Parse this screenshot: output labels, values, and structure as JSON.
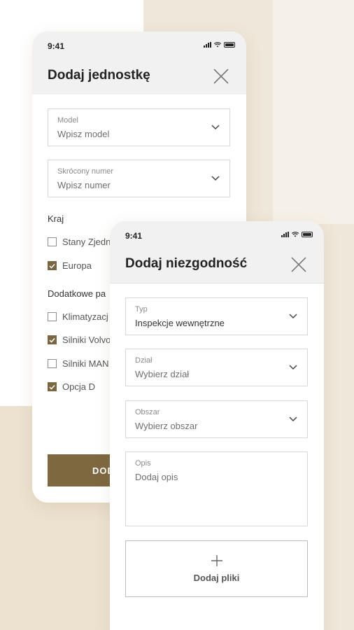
{
  "colors": {
    "accent": "#7d6840",
    "background": "#f3ede2",
    "header": "#f1f1f1"
  },
  "screen1": {
    "status_time": "9:41",
    "title": "Dodaj jednostkę",
    "fields": [
      {
        "label": "Model",
        "placeholder": "Wpisz model"
      },
      {
        "label": "Skrócony numer",
        "placeholder": "Wpisz numer"
      }
    ],
    "country_label": "Kraj",
    "countries": [
      {
        "label": "Stany Zjedn",
        "checked": false
      },
      {
        "label": "Europa",
        "checked": true
      }
    ],
    "params_label": "Dodatkowe pa",
    "params": [
      {
        "label": "Klimatyzacj",
        "checked": false
      },
      {
        "label": "Silniki Volvo",
        "checked": true
      },
      {
        "label": "Silniki MAN",
        "checked": false
      },
      {
        "label": "Opcja D",
        "checked": true
      }
    ],
    "submit_label": "DOD"
  },
  "screen2": {
    "status_time": "9:41",
    "title": "Dodaj niezgodność",
    "fields": [
      {
        "label": "Typ",
        "value": "Inspekcje wewnętrzne"
      },
      {
        "label": "Dział",
        "placeholder": "Wybierz dział"
      },
      {
        "label": "Obszar",
        "placeholder": "Wybierz obszar"
      }
    ],
    "description": {
      "label": "Opis",
      "placeholder": "Dodaj opis"
    },
    "upload_label": "Dodaj pliki"
  }
}
